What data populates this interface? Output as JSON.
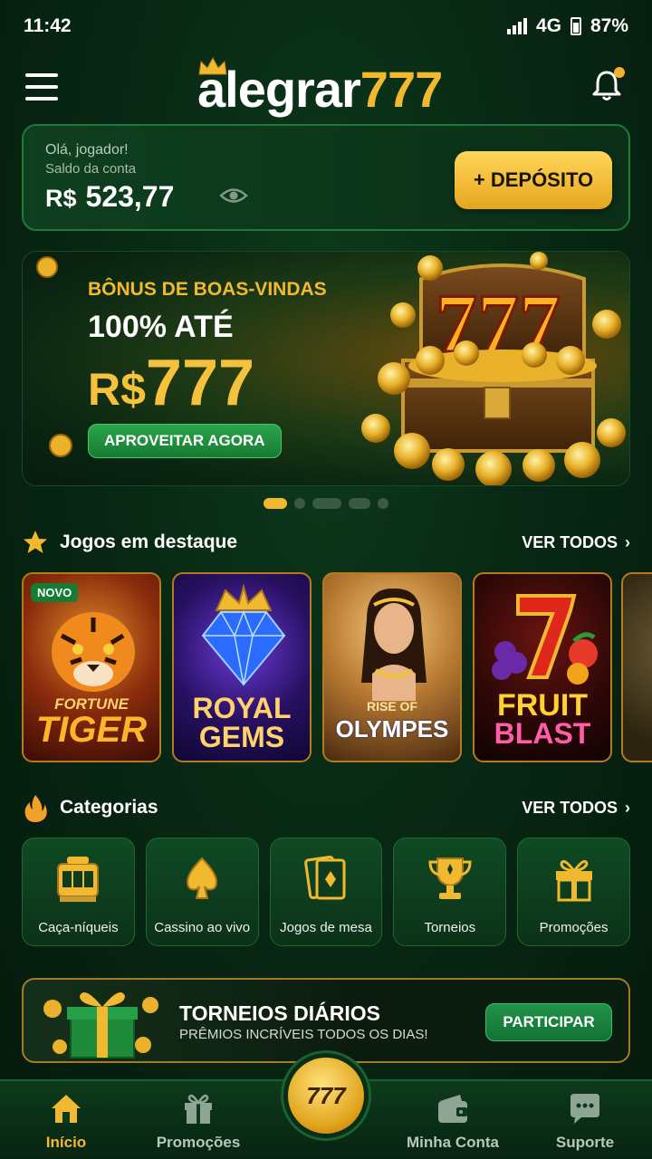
{
  "status_bar": {
    "time": "11:42",
    "network": "4G",
    "battery": "87%"
  },
  "header": {
    "logo_word": "alegrar",
    "logo_number": "777",
    "icons": {
      "menu": "menu-icon",
      "notifications": "bell-icon",
      "crown": "crown-icon"
    },
    "notification_dot_color": "#f5b12a"
  },
  "account": {
    "greeting": "Olá, jogador!",
    "balance_label": "Saldo da conta",
    "currency": "R$",
    "balance": "523,77",
    "deposit_label": "+ DEPÓSITO"
  },
  "banner": {
    "line1": "BÔNUS DE BOAS-VINDAS",
    "line2": "100% ATÉ",
    "currency": "R$",
    "amount": "777",
    "chest_text": "777",
    "cta": "APROVEITAR AGORA"
  },
  "carousel": {
    "slide_count": 5,
    "active_index": 0
  },
  "featured": {
    "title": "Jogos em destaque",
    "see_all": "VER TODOS",
    "games": [
      {
        "name_line1": "FORTUNE",
        "name_line2": "TIGER",
        "badge": "NOVO"
      },
      {
        "name_line1": "ROYAL",
        "name_line2": "GEMS",
        "badge": ""
      },
      {
        "name_line1": "RISE OF",
        "name_line2": "OLYMPES",
        "badge": ""
      },
      {
        "name_line1": "FRUIT",
        "name_line2": "BLAST",
        "badge": ""
      }
    ]
  },
  "categories": {
    "title": "Categorias",
    "see_all": "VER TODOS",
    "items": [
      {
        "label": "Caça-níqueis",
        "icon": "slot-machine-icon"
      },
      {
        "label": "Cassino ao vivo",
        "icon": "spade-icon"
      },
      {
        "label": "Jogos de mesa",
        "icon": "cards-icon"
      },
      {
        "label": "Torneios",
        "icon": "trophy-icon"
      },
      {
        "label": "Promoções",
        "icon": "gift-icon"
      }
    ]
  },
  "tournament_banner": {
    "title": "TORNEIOS DIÁRIOS",
    "subtitle": "PRÊMIOS INCRÍVEIS TODOS OS DIAS!",
    "button": "PARTICIPAR"
  },
  "bottom_nav": {
    "items": [
      {
        "label": "Início",
        "icon": "home-icon",
        "active": true
      },
      {
        "label": "Promoções",
        "icon": "gift-icon",
        "active": false
      },
      {
        "label": "Minha Conta",
        "icon": "wallet-icon",
        "active": false
      },
      {
        "label": "Suporte",
        "icon": "chat-icon",
        "active": false
      }
    ],
    "center_label": "777"
  },
  "colors": {
    "accent_gold": "#f1b92f",
    "green_primary": "#187b33",
    "background": "#082814"
  }
}
